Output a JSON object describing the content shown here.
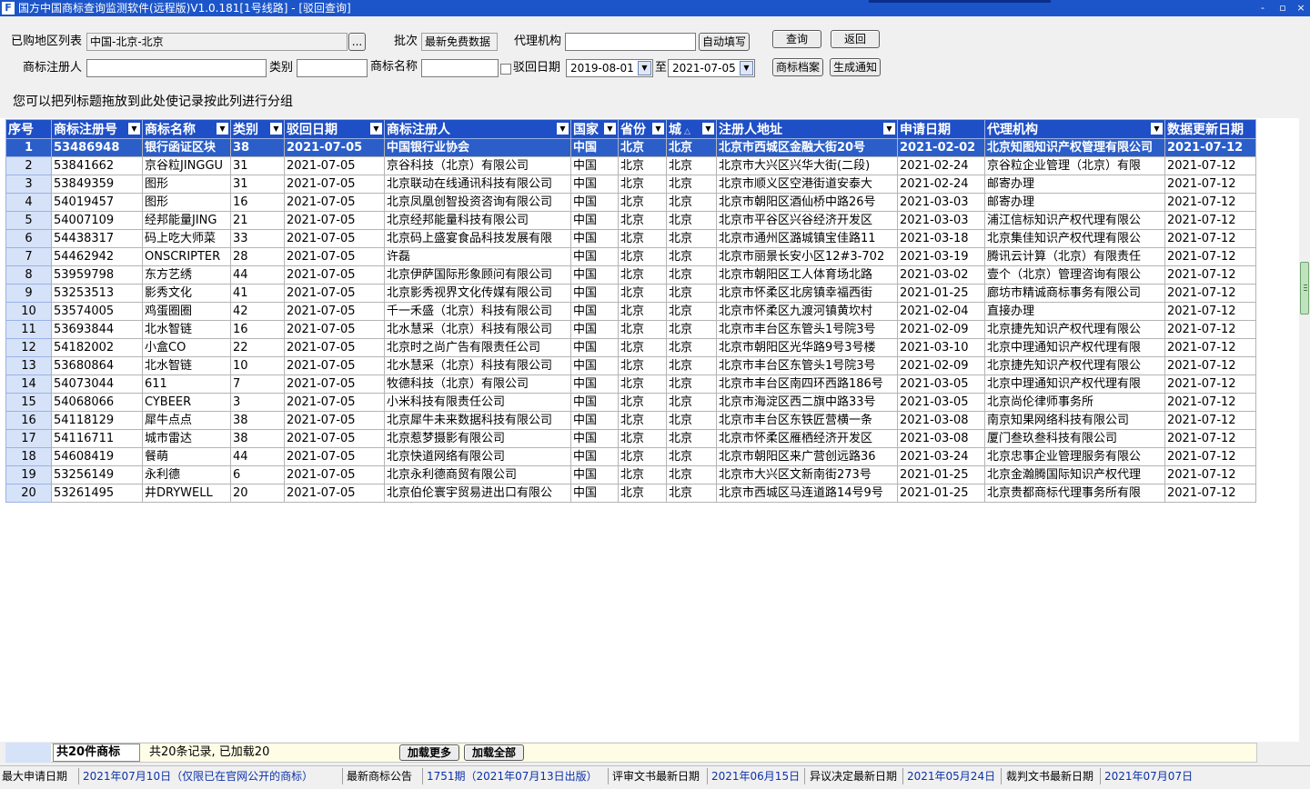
{
  "window": {
    "title": "国方中国商标查询监测软件(远程版)V1.0.181[1号线路] - [驳回查询]",
    "controls": [
      "-",
      "▫",
      "×"
    ]
  },
  "toolbar": {
    "region_label": "已购地区列表",
    "region_value": "中国-北京-北京",
    "region_browse": "...",
    "batch_label": "批次",
    "batch_value": "最新免费数据",
    "agency_label": "代理机构",
    "agency_value": "",
    "autofill_button": "自动填写",
    "query_button": "查询",
    "back_button": "返回",
    "registrant_label": "商标注册人",
    "registrant_value": "",
    "class_label": "类别",
    "class_value": "",
    "tm_name_label": "商标名称",
    "tm_name_value": "",
    "reject_date_label": "驳回日期",
    "date_from": "2019-08-01",
    "date_to_label": "至",
    "date_to": "2021-07-05",
    "archive_button": "商标档案",
    "notice_button": "生成通知"
  },
  "group_panel": {
    "hint": "您可以把列标题拖放到此处使记录按此列进行分组"
  },
  "grid": {
    "columns": [
      "序号",
      "商标注册号",
      "商标名称",
      "类别",
      "驳回日期",
      "商标注册人",
      "国家",
      "省份",
      "城",
      "注册人地址",
      "申请日期",
      "代理机构",
      "数据更新日期"
    ],
    "rows": [
      [
        "1",
        "53486948",
        "银行函证区块",
        "38",
        "2021-07-05",
        "中国银行业协会",
        "中国",
        "北京",
        "北京",
        "北京市西城区金融大街20号",
        "2021-02-02",
        "北京知图知识产权管理有限公司",
        "2021-07-12"
      ],
      [
        "2",
        "53841662",
        "京谷粒JINGGU",
        "31",
        "2021-07-05",
        "京谷科技（北京）有限公司",
        "中国",
        "北京",
        "北京",
        "北京市大兴区兴华大街(二段)",
        "2021-02-24",
        "京谷粒企业管理（北京）有限",
        "2021-07-12"
      ],
      [
        "3",
        "53849359",
        "图形",
        "31",
        "2021-07-05",
        "北京联动在线通讯科技有限公司",
        "中国",
        "北京",
        "北京",
        "北京市顺义区空港街道安泰大",
        "2021-02-24",
        "邮寄办理",
        "2021-07-12"
      ],
      [
        "4",
        "54019457",
        "图形",
        "16",
        "2021-07-05",
        "北京凤凰创智投资咨询有限公司",
        "中国",
        "北京",
        "北京",
        "北京市朝阳区酒仙桥中路26号",
        "2021-03-03",
        "邮寄办理",
        "2021-07-12"
      ],
      [
        "5",
        "54007109",
        "经邦能量JING",
        "21",
        "2021-07-05",
        "北京经邦能量科技有限公司",
        "中国",
        "北京",
        "北京",
        "北京市平谷区兴谷经济开发区",
        "2021-03-03",
        "浦江信标知识产权代理有限公",
        "2021-07-12"
      ],
      [
        "6",
        "54438317",
        "码上吃大师菜",
        "33",
        "2021-07-05",
        "北京码上盛宴食品科技发展有限",
        "中国",
        "北京",
        "北京",
        "北京市通州区潞城镇宝佳路11",
        "2021-03-18",
        "北京集佳知识产权代理有限公",
        "2021-07-12"
      ],
      [
        "7",
        "54462942",
        "ONSCRIPTER",
        "28",
        "2021-07-05",
        "许磊",
        "中国",
        "北京",
        "北京",
        "北京市丽景长安小区12#3-702",
        "2021-03-19",
        "腾讯云计算（北京）有限责任",
        "2021-07-12"
      ],
      [
        "8",
        "53959798",
        "东方艺绣",
        "44",
        "2021-07-05",
        "北京伊萨国际形象顾问有限公司",
        "中国",
        "北京",
        "北京",
        "北京市朝阳区工人体育场北路",
        "2021-03-02",
        "壹个（北京）管理咨询有限公",
        "2021-07-12"
      ],
      [
        "9",
        "53253513",
        "影秀文化",
        "41",
        "2021-07-05",
        "北京影秀视界文化传媒有限公司",
        "中国",
        "北京",
        "北京",
        "北京市怀柔区北房镇幸福西街",
        "2021-01-25",
        "廊坊市精诚商标事务有限公司",
        "2021-07-12"
      ],
      [
        "10",
        "53574005",
        "鸡蛋圈圈",
        "42",
        "2021-07-05",
        "千一禾盛（北京）科技有限公司",
        "中国",
        "北京",
        "北京",
        "北京市怀柔区九渡河镇黄坎村",
        "2021-02-04",
        "直接办理",
        "2021-07-12"
      ],
      [
        "11",
        "53693844",
        "北水智链",
        "16",
        "2021-07-05",
        "北水慧采（北京）科技有限公司",
        "中国",
        "北京",
        "北京",
        "北京市丰台区东管头1号院3号",
        "2021-02-09",
        "北京捷先知识产权代理有限公",
        "2021-07-12"
      ],
      [
        "12",
        "54182002",
        "小盒CO",
        "22",
        "2021-07-05",
        "北京时之尚广告有限责任公司",
        "中国",
        "北京",
        "北京",
        "北京市朝阳区光华路9号3号楼",
        "2021-03-10",
        "北京中理通知识产权代理有限",
        "2021-07-12"
      ],
      [
        "13",
        "53680864",
        "北水智链",
        "10",
        "2021-07-05",
        "北水慧采（北京）科技有限公司",
        "中国",
        "北京",
        "北京",
        "北京市丰台区东管头1号院3号",
        "2021-02-09",
        "北京捷先知识产权代理有限公",
        "2021-07-12"
      ],
      [
        "14",
        "54073044",
        "611",
        "7",
        "2021-07-05",
        "牧德科技（北京）有限公司",
        "中国",
        "北京",
        "北京",
        "北京市丰台区南四环西路186号",
        "2021-03-05",
        "北京中理通知识产权代理有限",
        "2021-07-12"
      ],
      [
        "15",
        "54068066",
        "CYBEER",
        "3",
        "2021-07-05",
        "小米科技有限责任公司",
        "中国",
        "北京",
        "北京",
        "北京市海淀区西二旗中路33号",
        "2021-03-05",
        "北京尚伦律师事务所",
        "2021-07-12"
      ],
      [
        "16",
        "54118129",
        "犀牛点点",
        "38",
        "2021-07-05",
        "北京犀牛未来数据科技有限公司",
        "中国",
        "北京",
        "北京",
        "北京市丰台区东铁匠营横一条",
        "2021-03-08",
        "南京知果网络科技有限公司",
        "2021-07-12"
      ],
      [
        "17",
        "54116711",
        "城市雷达",
        "38",
        "2021-07-05",
        "北京惹梦摄影有限公司",
        "中国",
        "北京",
        "北京",
        "北京市怀柔区雁栖经济开发区",
        "2021-03-08",
        "厦门叁玖叁科技有限公司",
        "2021-07-12"
      ],
      [
        "18",
        "54608419",
        "餐萌",
        "44",
        "2021-07-05",
        "北京快道网络有限公司",
        "中国",
        "北京",
        "北京",
        "北京市朝阳区来广营创远路36",
        "2021-03-24",
        "北京忠事企业管理服务有限公",
        "2021-07-12"
      ],
      [
        "19",
        "53256149",
        "永利德",
        "6",
        "2021-07-05",
        "北京永利德商贸有限公司",
        "中国",
        "北京",
        "北京",
        "北京市大兴区文新南街273号",
        "2021-01-25",
        "北京金瀚腾国际知识产权代理",
        "2021-07-12"
      ],
      [
        "20",
        "53261495",
        "井DRYWELL",
        "20",
        "2021-07-05",
        "北京伯伦寰宇贸易进出口有限公",
        "中国",
        "北京",
        "北京",
        "北京市西城区马连道路14号9号",
        "2021-01-25",
        "北京贵都商标代理事务所有限",
        "2021-07-12"
      ]
    ]
  },
  "footer": {
    "total": "共20件商标",
    "info": "共20条记录, 已加载20",
    "load_more": "加载更多",
    "load_all": "加载全部"
  },
  "statusbar": {
    "max_apply_label": "最大申请日期",
    "max_apply_value": "2021年07月10日（仅限已在官网公开的商标）",
    "latest_notice_label": "最新商标公告",
    "latest_notice_value": "1751期（2021年07月13日出版）",
    "review_doc_label": "评审文书最新日期",
    "review_doc_value": "2021年06月15日",
    "objection_label": "异议决定最新日期",
    "objection_value": "2021年05月24日",
    "judgment_label": "裁判文书最新日期",
    "judgment_value": "2021年07月07日"
  }
}
